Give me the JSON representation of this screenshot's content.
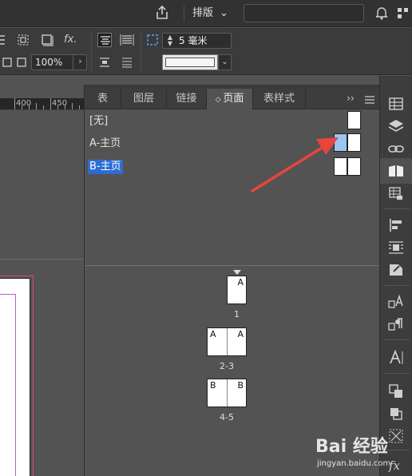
{
  "topbar": {
    "workspace_label": "排版",
    "workspace_chevron": "⌄",
    "icons": [
      "share-icon",
      "bell-icon",
      "grid-icon"
    ]
  },
  "controlbar": {
    "zoom_percent": "100%",
    "zoom_arrow": "›",
    "fx_label": "fx.",
    "gutter_value": "5 毫米",
    "stroke_arrow": "⌄"
  },
  "ruler": {
    "labels": [
      "400",
      "450"
    ]
  },
  "panel": {
    "tabs": [
      {
        "label": "表"
      },
      {
        "label": "图层"
      },
      {
        "label": "链接"
      },
      {
        "label": "页面",
        "active": true
      },
      {
        "label": "表样式"
      }
    ],
    "more_label": "››",
    "masters": [
      {
        "label": "[无]",
        "selected": false
      },
      {
        "label": "A-主页",
        "selected": false
      },
      {
        "label": "B-主页",
        "selected": true
      }
    ],
    "pages": [
      {
        "number": "1",
        "left_master": "",
        "right_master": "A"
      },
      {
        "number": "2-3",
        "left_master": "A",
        "right_master": "A"
      },
      {
        "number": "4-5",
        "left_master": "B",
        "right_master": "B"
      }
    ]
  },
  "dock": {
    "icons": [
      "table-icon",
      "layers-icon",
      "links-icon",
      "pages-icon",
      "table-styles-icon",
      "align-icon",
      "text-wrap-icon",
      "object-styles-icon",
      "character-styles-icon",
      "paragraph-styles-icon",
      "glyphs-icon",
      "transform-icon",
      "pathfinder-icon",
      "swatches-icon",
      "effects-icon"
    ]
  },
  "annotation": {
    "arrow_color": "#e8453c"
  },
  "watermark": {
    "main": "Bai 经验",
    "sub": "jingyan.baidu.com"
  },
  "colors": {
    "selection_blue": "#2d6dd3",
    "thumb_highlight": "#9cc4f0",
    "panel_bg": "#535353",
    "bar_bg": "#323232"
  }
}
